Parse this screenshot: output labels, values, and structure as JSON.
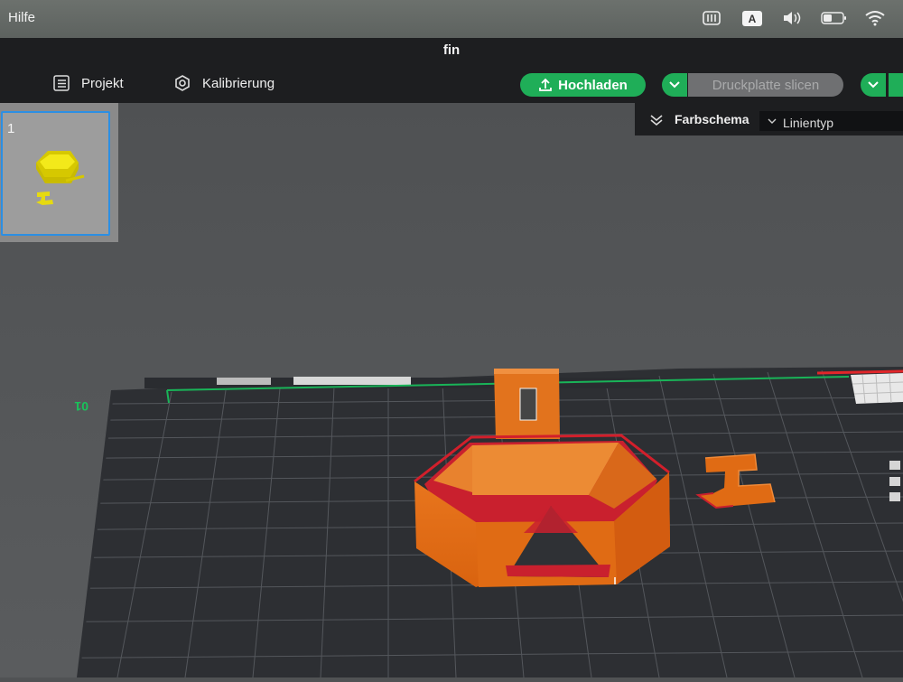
{
  "menubar": {
    "menu_help": "Hilfe",
    "input_source": "A",
    "icons": [
      "keyboard-grid-icon",
      "input-source-icon",
      "volume-icon",
      "battery-icon",
      "wifi-icon"
    ]
  },
  "window": {
    "title": "fin"
  },
  "toolbar": {
    "tab_project": "Projekt",
    "tab_calibration": "Kalibrierung",
    "upload_label": "Hochladen",
    "slice_label": "Druckplatte slicen",
    "accent_color": "#1fae58"
  },
  "plates": [
    {
      "number": "1"
    }
  ],
  "color_scheme": {
    "label": "Farbschema",
    "selected": "Linientyp"
  },
  "bed": {
    "axis_label": "01"
  }
}
